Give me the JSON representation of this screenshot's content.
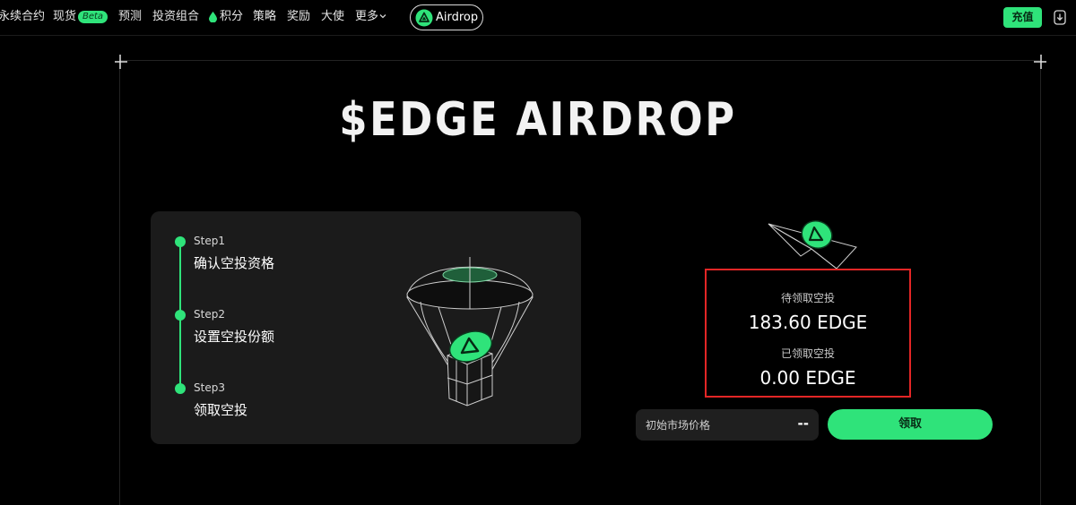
{
  "nav": {
    "items": [
      "永续合约",
      "现货",
      "预测",
      "投资组合",
      "积分",
      "策略",
      "奖励",
      "大使",
      "更多"
    ],
    "beta_badge": "Beta",
    "airdrop": "Airdrop",
    "recharge": "充值"
  },
  "hero": {
    "title": "$EDGE AIRDROP"
  },
  "steps": [
    {
      "num": "Step1",
      "text": "确认空投资格"
    },
    {
      "num": "Step2",
      "text": "设置空投份额"
    },
    {
      "num": "Step3",
      "text": "领取空投"
    }
  ],
  "claim": {
    "pending_label": "待领取空投",
    "pending_value": "183.60 EDGE",
    "claimed_label": "已领取空投",
    "claimed_value": "0.00 EDGE"
  },
  "price": {
    "label": "初始市场价格",
    "value": "--"
  },
  "claim_button": "领取",
  "colors": {
    "accent": "#2fe37a",
    "highlight": "#e32626",
    "background": "#000000"
  }
}
